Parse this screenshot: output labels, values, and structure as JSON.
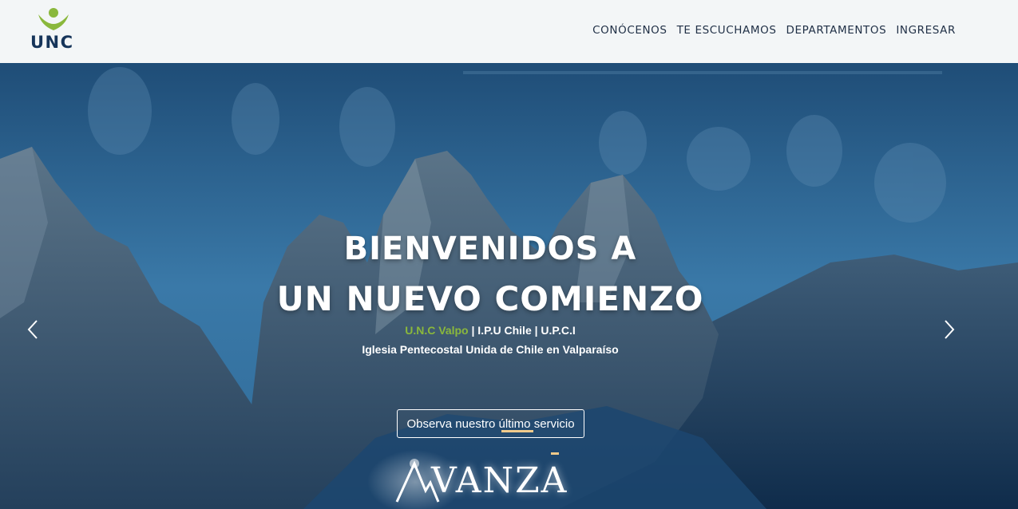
{
  "brand": {
    "logo_text": "UNC",
    "logo_icon": "person-leaf-icon",
    "accent": "#8ab83c",
    "navy": "#16355a"
  },
  "nav": {
    "items": [
      {
        "label": "CONÓCENOS"
      },
      {
        "label": "TE ESCUCHAMOS"
      },
      {
        "label": "DEPARTAMENTOS"
      },
      {
        "label": "INGRESAR"
      }
    ]
  },
  "hero": {
    "title_line1": "BIENVENIDOS A",
    "title_line2": "UN NUEVO COMIENZO",
    "affiliation_highlight": "U.N.C Valpo",
    "affiliation_rest": " | I.P.U Chile | U.P.C.I",
    "church_name": "Iglesia Pentecostal Unida de Chile en Valparaíso",
    "cta_label": "Observa nuestro último servicio",
    "campaign_logo_text": "VANZA",
    "prev_icon": "chevron-left-icon",
    "next_icon": "chevron-right-icon"
  }
}
